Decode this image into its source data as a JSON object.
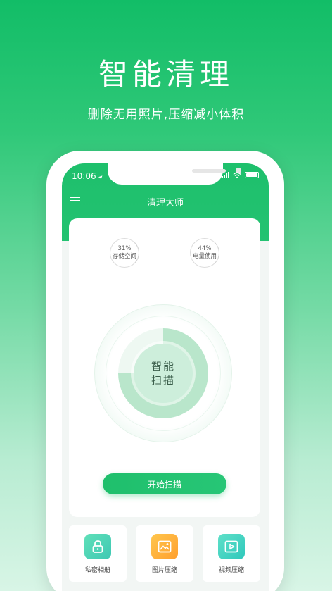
{
  "promo": {
    "headline": "智能清理",
    "subline": "删除无用照片,压缩减小体积"
  },
  "status_bar": {
    "time": "10:06",
    "location_glyph": "➤"
  },
  "app": {
    "title": "清理大师",
    "menu_icon": "menu-icon",
    "accent": "#1fbf6c"
  },
  "gauges": [
    {
      "percent": "31%",
      "label": "存储空间"
    },
    {
      "percent": "44%",
      "label": "电量使用"
    }
  ],
  "scan": {
    "line1": "智能",
    "line2": "扫描",
    "progress": 0.75
  },
  "start_button": {
    "label": "开始扫描"
  },
  "tools": [
    {
      "label": "私密相册",
      "icon": "lock-icon",
      "color": "#4fd6b4"
    },
    {
      "label": "图片压缩",
      "icon": "image-icon",
      "color": "#ffb43a"
    },
    {
      "label": "视频压缩",
      "icon": "video-icon",
      "color": "#41d4c0"
    }
  ]
}
